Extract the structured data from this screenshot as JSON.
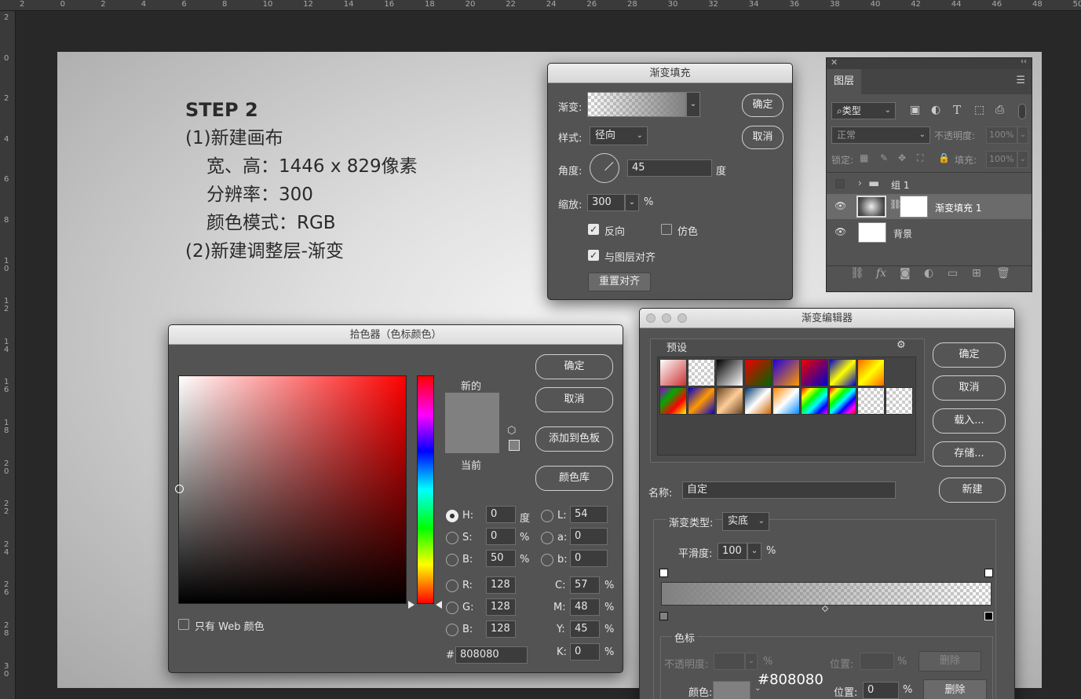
{
  "rulers": {
    "top": [
      "2",
      "0",
      "2",
      "4",
      "6",
      "8",
      "10",
      "12",
      "14",
      "16",
      "18",
      "20",
      "22",
      "24",
      "26",
      "28",
      "30",
      "32",
      "34",
      "36",
      "38",
      "40",
      "42",
      "44",
      "46",
      "48",
      "50"
    ],
    "left": [
      "2",
      "0",
      "2",
      "4",
      "6",
      "8",
      "1\n0",
      "1\n2",
      "1\n4",
      "1\n6",
      "1\n8",
      "2\n0",
      "2\n2",
      "2\n4",
      "2\n6",
      "2\n8",
      "3\n0"
    ]
  },
  "canvas": {
    "title": "STEP 2",
    "lines": [
      "(1)新建画布",
      "宽、高：1446 x 829像素",
      "分辨率：300",
      "颜色模式：RGB",
      "(2)新建调整层-渐变"
    ]
  },
  "gradient_fill": {
    "title": "渐变填充",
    "gradient_label": "渐变:",
    "style_label": "样式:",
    "style_value": "径向",
    "angle_label": "角度:",
    "angle_value": "45",
    "angle_unit": "度",
    "scale_label": "缩放:",
    "scale_value": "300",
    "scale_unit": "%",
    "reverse_label": "反向",
    "reverse_checked": true,
    "dither_label": "仿色",
    "dither_checked": false,
    "align_label": "与图层对齐",
    "align_checked": true,
    "reset_label": "重置对齐",
    "ok": "确定",
    "cancel": "取消"
  },
  "layers": {
    "tab": "图层",
    "filter_placeholder": "类型",
    "blend_mode": "正常",
    "opacity_label": "不透明度:",
    "opacity_value": "100%",
    "lock_label": "锁定:",
    "fill_label": "填充:",
    "fill_value": "100%",
    "items": [
      {
        "name": "组 1",
        "type": "group",
        "visible": false
      },
      {
        "name": "渐变填充 1",
        "type": "gradient",
        "visible": true,
        "selected": true
      },
      {
        "name": "背景",
        "type": "background",
        "visible": true
      }
    ]
  },
  "color_picker": {
    "title": "拾色器（色标颜色）",
    "ok": "确定",
    "cancel": "取消",
    "add_swatch": "添加到色板",
    "color_library": "颜色库",
    "new_label": "新的",
    "current_label": "当前",
    "web_only_label": "只有 Web 颜色",
    "new_color": "#808080",
    "current_color": "#808080",
    "hsb": [
      {
        "key": "H:",
        "value": "0",
        "unit": "度",
        "selected": true
      },
      {
        "key": "S:",
        "value": "0",
        "unit": "%",
        "selected": false
      },
      {
        "key": "B:",
        "value": "50",
        "unit": "%",
        "selected": false
      }
    ],
    "rgb": [
      {
        "key": "R:",
        "value": "128"
      },
      {
        "key": "G:",
        "value": "128"
      },
      {
        "key": "B:",
        "value": "128"
      }
    ],
    "lab": [
      {
        "key": "L:",
        "value": "54"
      },
      {
        "key": "a:",
        "value": "0"
      },
      {
        "key": "b:",
        "value": "0"
      }
    ],
    "cmyk": [
      {
        "key": "C:",
        "value": "57",
        "unit": "%"
      },
      {
        "key": "M:",
        "value": "48",
        "unit": "%"
      },
      {
        "key": "Y:",
        "value": "45",
        "unit": "%"
      },
      {
        "key": "K:",
        "value": "0",
        "unit": "%"
      }
    ],
    "hex_label": "#",
    "hex_value": "808080"
  },
  "gradient_editor": {
    "title": "渐变编辑器",
    "presets_label": "预设",
    "ok": "确定",
    "cancel": "取消",
    "load": "载入...",
    "save": "存储...",
    "name_label": "名称:",
    "name_value": "自定",
    "new_button": "新建",
    "type_label": "渐变类型:",
    "type_value": "实底",
    "smooth_label": "平滑度:",
    "smooth_value": "100",
    "smooth_unit": "%",
    "stops_label": "色标",
    "opacity_label": "不透明度:",
    "opacity_unit": "%",
    "location_label": "位置:",
    "location_unit": "%",
    "delete_label": "删除",
    "color_label": "颜色:",
    "color_hex_tooltip": "#808080",
    "location_value": "0"
  }
}
